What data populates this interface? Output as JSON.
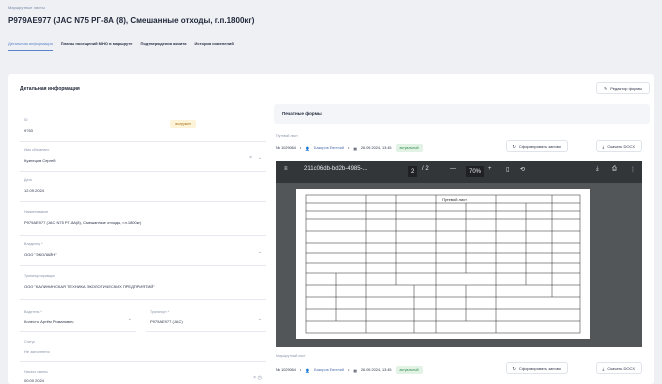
{
  "app": {
    "breadcrumb": "Маршрутные листы",
    "title": "P979AE977 (JAC N75 РГ-8А (8), Смешанные отходы, г.п.1800кг)"
  },
  "tabs": [
    {
      "label": "Детальная информация",
      "active": true
    },
    {
      "label": "Планы посещений МНО в маршруте",
      "active": false
    },
    {
      "label": "Подтверждения акиита",
      "active": false
    },
    {
      "label": "История изменений",
      "active": false
    }
  ],
  "details": {
    "header": "Детальная информация",
    "edit_button": "Редактор формы"
  },
  "form": {
    "id": {
      "label": "ID",
      "value": "9?53",
      "badge": "выгружен"
    },
    "driver": {
      "label": "Имя обновлено",
      "value": "Кузнецов Сергей"
    },
    "date": {
      "label": "Дата",
      "value": "12.09.2024"
    },
    "name": {
      "label": "Наименование",
      "value": "P979AE977 (JAC N75 РГ-8А(8), Смешанные отходы, г.п.1800кг)"
    },
    "carrier": {
      "label": "Владелец *",
      "value": "ООО \"ЭКОЛАЙН\""
    },
    "transport_org": {
      "label": "Транспортировщик",
      "value": "ООО \"КАЛИНИНСКАЯ ТЕХНИКА ЭКОЛОГИЧЕСКИХ ПРЕДПРИЯТИЙ\""
    },
    "driver_select": {
      "label": "Водитель *",
      "value": "Колесто Артём Романович"
    },
    "transport": {
      "label": "Транспорт *",
      "value": "P979AE977 (JAC)"
    },
    "status": {
      "label": "Статус",
      "value": "Не заполнено"
    },
    "shift": {
      "label": "Начало смены",
      "value": "00:00 2024"
    }
  },
  "prints": {
    "header": "Печатные формы",
    "documents": [
      {
        "label": "Путевой лист",
        "number": "№ 1029064",
        "author": "Бакиров Евгений",
        "date": "26.09.2024, 13:45",
        "status": "актуальный",
        "regen_button": "Сформировать заново",
        "download_button": "Скачать DOCX"
      },
      {
        "label": "Маршрутный лист",
        "number": "№ 1029064",
        "author": "Бакиров Евгений",
        "date": "26.09.2024, 13:45",
        "status": "актуальный",
        "regen_button": "Сформировать заново",
        "download_button": "Скачать DOCX"
      }
    ],
    "viewer": {
      "file": "211c06db-bd2b-4985-...",
      "page": "2",
      "pages": "/ 2",
      "zoom": "70%",
      "minus": "—",
      "plus": "+",
      "sheet_title": "Путевой лист"
    }
  },
  "colors": {
    "accent": "#5b83c9",
    "status_green": "#2f8a4a",
    "badge_amber": "#a86c14"
  }
}
